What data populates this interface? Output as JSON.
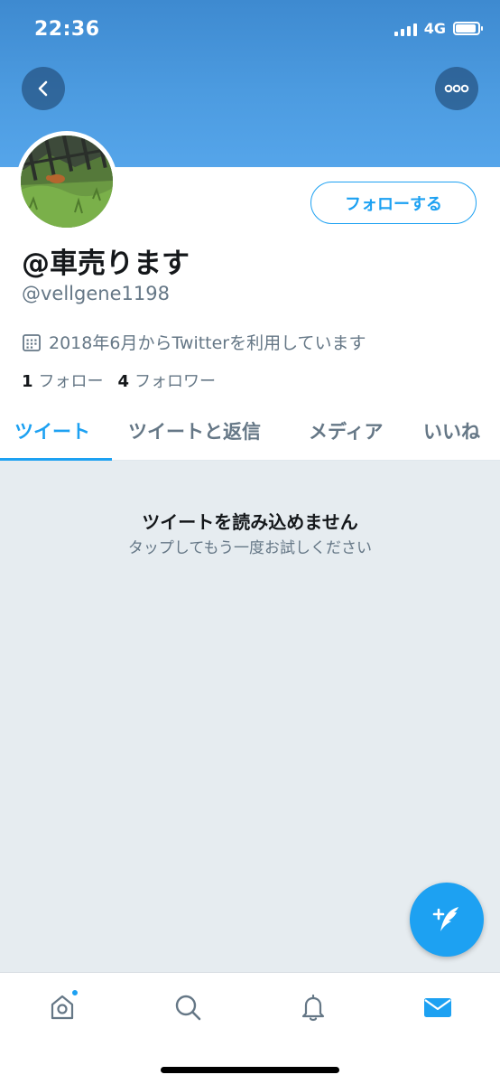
{
  "status_bar": {
    "time": "22:36",
    "network": "4G",
    "signal_bars": 4,
    "battery_level": 0.8
  },
  "header": {
    "back_icon": "chevron-left-icon",
    "more_icon": "more-horizontal-icon",
    "color": "#4c9be0"
  },
  "profile": {
    "display_name": "@車売ります",
    "handle": "@vellgene1198",
    "joined_text": "2018年6月からTwitterを利用しています",
    "joined_icon": "calendar-icon",
    "follow_button_label": "フォローする",
    "following_count": "1",
    "following_label": "フォロー",
    "followers_count": "4",
    "followers_label": "フォロワー"
  },
  "tabs": [
    {
      "label": "ツイート",
      "active": true
    },
    {
      "label": "ツイートと返信",
      "active": false
    },
    {
      "label": "メディア",
      "active": false
    },
    {
      "label": "いいね",
      "active": false
    }
  ],
  "error": {
    "title": "ツイートを読み込めません",
    "subtitle": "タップしてもう一度お試しください"
  },
  "fab": {
    "icon": "compose-tweet-icon",
    "color": "#1da1f2"
  },
  "bottom_nav": [
    {
      "icon": "home-icon",
      "active": false,
      "has_badge": true
    },
    {
      "icon": "search-icon",
      "active": false
    },
    {
      "icon": "bell-icon",
      "active": false
    },
    {
      "icon": "mail-icon",
      "active": true
    }
  ],
  "colors": {
    "accent": "#1da1f2",
    "secondary_text": "#657786",
    "background": "#e6ecf0"
  }
}
